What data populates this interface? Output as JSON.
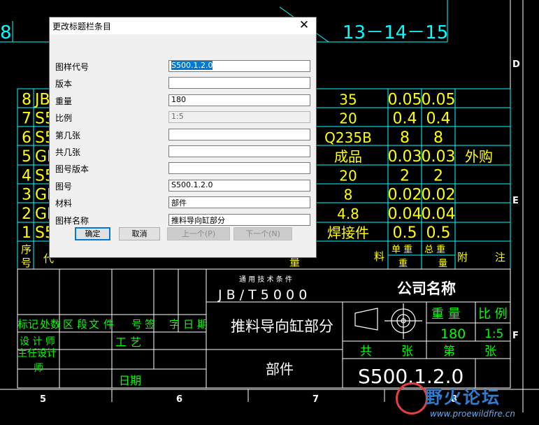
{
  "dialog": {
    "title": "更改标题栏条目",
    "close_glyph": "✕",
    "fields": [
      {
        "label": "图样代号",
        "value": "S500.1.2.0",
        "selected": true
      },
      {
        "label": "版本",
        "value": ""
      },
      {
        "label": "重量",
        "value": "180"
      },
      {
        "label": "比例",
        "value": "1:5",
        "readonly": true
      },
      {
        "label": "第几张",
        "value": ""
      },
      {
        "label": "共几张",
        "value": ""
      },
      {
        "label": "图号版本",
        "value": ""
      },
      {
        "label": "图号",
        "value": "S500.1.2.0"
      },
      {
        "label": "材料",
        "value": "部件"
      },
      {
        "label": "图样名称",
        "value": "推料导向缸部分"
      }
    ],
    "buttons": {
      "ok": "确定",
      "cancel": "取消",
      "prev": "上一个(P)",
      "next": "下一个(N)"
    }
  },
  "cad": {
    "top_left_fragment": "8",
    "top_right_text": "13－14－15",
    "zone_letters": [
      "D",
      "E",
      "F"
    ],
    "column_numbers": [
      "5",
      "6",
      "7",
      "8"
    ],
    "bom_rows": [
      {
        "seq": "8",
        "code": "JB",
        "material": "35",
        "w1": "0.05",
        "w2": "0.05",
        "note": ""
      },
      {
        "seq": "7",
        "code": "S5",
        "material": "20",
        "w1": "0.4",
        "w2": "0.4",
        "note": ""
      },
      {
        "seq": "6",
        "code": "S5",
        "material": "Q235B",
        "w1": "8",
        "w2": "8",
        "note": ""
      },
      {
        "seq": "5",
        "code": "GB",
        "material": "成品",
        "w1": "0.03",
        "w2": "0.03",
        "note": "外购"
      },
      {
        "seq": "4",
        "code": "S5",
        "material": "20",
        "w1": "2",
        "w2": "2",
        "note": ""
      },
      {
        "seq": "3",
        "code": "GB",
        "material": "8",
        "w1": "0.02",
        "w2": "0.02",
        "note": ""
      },
      {
        "seq": "2",
        "code": "GB",
        "material": "4.8",
        "w1": "0.04",
        "w2": "0.04",
        "note": ""
      },
      {
        "seq": "1",
        "code": "S5",
        "material": "焊接件",
        "w1": "0.5",
        "w2": "0.5",
        "note": ""
      }
    ],
    "header": {
      "seq_a": "序",
      "seq_b": "号",
      "code_a": "代",
      "qty": "量",
      "material": "料",
      "unit_weight_a": "单 重",
      "unit_weight_b": "重",
      "total_weight_a": "总 重",
      "total_weight_b": "量",
      "note_a": "附",
      "note_b": "注"
    },
    "title_block": {
      "tech_cond": "通 用 技 术 条 件",
      "standard": "J B / T  5 0 0 0",
      "company": "公司名称",
      "drawing_name": "推料导向缸部分",
      "material": "部件",
      "weight_label": "重  量",
      "scale_label": "比 例",
      "weight": "180",
      "scale": "1:5",
      "total_sheets_a": "共",
      "total_sheets_b": "张",
      "sheet_a": "第",
      "sheet_b": "张",
      "drawing_no": "S500.1.2.0",
      "rev_row": [
        "标记",
        "处数",
        "区",
        "段",
        "文",
        "件",
        "号",
        "签",
        "字",
        "日",
        "期"
      ],
      "designer": "设 计 师",
      "chief": "主任设计",
      "chief_b": "师",
      "process": "工  艺",
      "date": "日期"
    }
  },
  "watermark": {
    "text": "野火论坛",
    "url": "www.proewildfire.cn"
  }
}
